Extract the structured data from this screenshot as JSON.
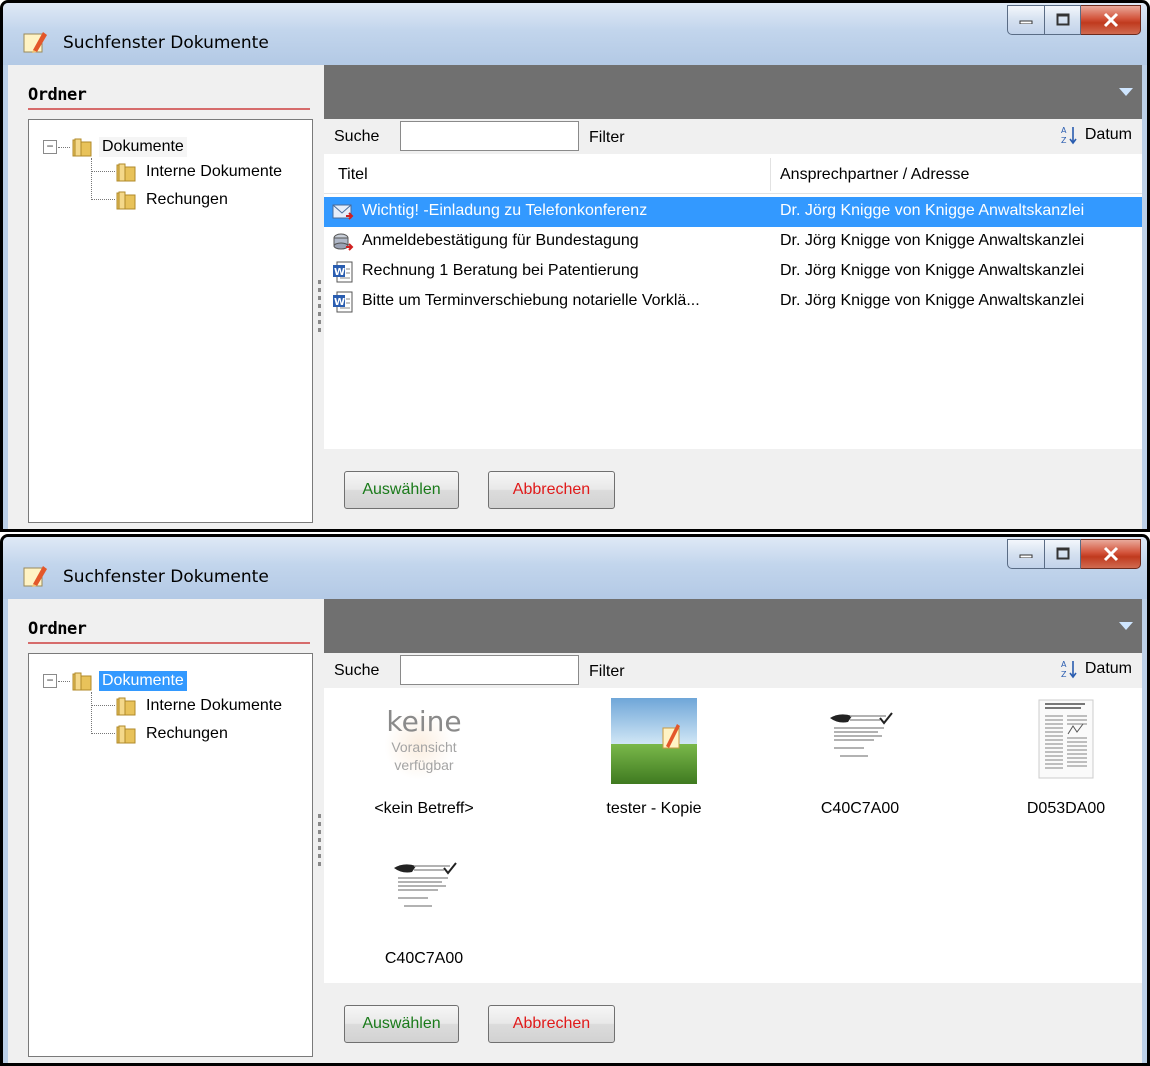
{
  "window_title": "Suchfenster Dokumente",
  "folders_header": "Ordner",
  "tree": {
    "root": "Dokumente",
    "children": [
      "Interne Dokumente",
      "Rechungen"
    ]
  },
  "search": {
    "label": "Suche",
    "value": "",
    "filter_label": "Filter",
    "sort_label": "Datum"
  },
  "columns": {
    "title": "Titel",
    "contact": "Ansprechpartner / Adresse"
  },
  "documents": [
    {
      "title": "Wichtig! -Einladung zu Telefonkonferenz",
      "contact": "Dr. Jörg Knigge von Knigge Anwaltskanzlei",
      "icon": "email-icon",
      "selected": true
    },
    {
      "title": "Anmeldebestätigung für Bundestagung",
      "contact": "Dr. Jörg Knigge von Knigge Anwaltskanzlei",
      "icon": "archive-icon",
      "selected": false
    },
    {
      "title": "Rechnung 1 Beratung bei Patentierung",
      "contact": "Dr. Jörg Knigge von Knigge Anwaltskanzlei",
      "icon": "word-doc-icon",
      "selected": false
    },
    {
      "title": "Bitte um Terminverschiebung notarielle Vorklä...",
      "contact": "Dr. Jörg Knigge von Knigge Anwaltskanzlei",
      "icon": "word-doc-icon",
      "selected": false
    }
  ],
  "thumbnails": [
    {
      "label": "<kein Betreff>",
      "preview": "no-preview-placeholder",
      "placeholder_big": "keine",
      "placeholder_line1": "Voransicht",
      "placeholder_line2": "verfügbar"
    },
    {
      "label": "tester - Kopie",
      "preview": "landscape-image"
    },
    {
      "label": "C40C7A00",
      "preview": "scanned-letter"
    },
    {
      "label": "D053DA00",
      "preview": "scanned-document"
    },
    {
      "label": "C40C7A00",
      "preview": "scanned-letter"
    }
  ],
  "buttons": {
    "select": "Auswählen",
    "cancel": "Abbrechen"
  },
  "colors": {
    "selection": "#3399ff",
    "ok_text": "#1a7a1a",
    "cancel_text": "#e01a1a",
    "header_line": "#d66b6b",
    "gray_bar": "#707070"
  }
}
